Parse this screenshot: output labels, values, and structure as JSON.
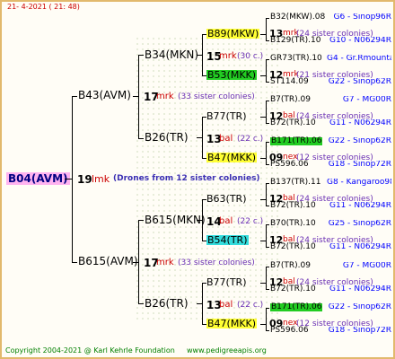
{
  "header": {
    "date": "21-  4-2021 ( 21: 48)"
  },
  "footer": {
    "copyright": "Copyright 2004-2021 @ Karl Kehrle Foundation",
    "site": "www.pedigreeapis.org"
  },
  "root": {
    "name": "B04(AVM)",
    "num": "19",
    "mk": "lmk",
    "note": "(Drones from 12 sister colonies)"
  },
  "gen1": [
    {
      "name": "B43(AVM)",
      "num": "17",
      "mk": "mrk",
      "note": "(33 sister colonies)"
    },
    {
      "name": "B615(AVM)",
      "num": "17",
      "mk": "mrk",
      "note": "(33 sister colonies)"
    }
  ],
  "gen2": [
    {
      "name": "B34(MKN)",
      "num": "15",
      "mk": "mrk",
      "note": "(30 c.)"
    },
    {
      "name": "B26(TR)",
      "num": "13",
      "mk": "bal",
      "note": "(22 c.)"
    },
    {
      "name": "B615(MKN)",
      "num": "14",
      "mk": "bal",
      "note": "(22 c.)"
    },
    {
      "name": "B26(TR)",
      "num": "13",
      "mk": "bal",
      "note": "(22 c.)"
    }
  ],
  "gen3": [
    {
      "name": "B89(MKW)",
      "num": "13",
      "mk": "mrk",
      "note": "(24 sister colonies)",
      "hl": "y"
    },
    {
      "name": "B53(MKK)",
      "num": "12",
      "mk": "mrk",
      "note": "(21 sister colonies)",
      "hl": "g"
    },
    {
      "name": "B77(TR)",
      "num": "12",
      "mk": "bal",
      "note": "(24 sister colonies)",
      "hl": ""
    },
    {
      "name": "B47(MKK)",
      "num": "09",
      "mk": "nex",
      "note": "(12 sister colonies)",
      "hl": "y"
    },
    {
      "name": "B63(TR)",
      "num": "12",
      "mk": "bal",
      "note": "(24 sister colonies)",
      "hl": ""
    },
    {
      "name": "B54(TR)",
      "num": "12",
      "mk": "bal",
      "note": "(24 sister colonies)",
      "hl": "c"
    },
    {
      "name": "B77(TR)",
      "num": "12",
      "mk": "bal",
      "note": "(24 sister colonies)",
      "hl": ""
    },
    {
      "name": "B47(MKK)",
      "num": "09",
      "mk": "nex",
      "note": "(12 sister colonies)",
      "hl": "y"
    }
  ],
  "gen4": [
    {
      "left": "B32(MKW).08",
      "right": "G6 - Sinop96R",
      "hl": ""
    },
    {
      "left": "B129(TR).10",
      "right": "G10 - N06294R",
      "hl": ""
    },
    {
      "left": "GR73(TR).10",
      "right": "G4 - Gr.Rmounta",
      "hl": ""
    },
    {
      "left": "ST114.09",
      "right": "G22 - Sinop62R",
      "hl": ""
    },
    {
      "left": "B7(TR).09",
      "right": "G7 - MG00R",
      "hl": ""
    },
    {
      "left": "B72(TR).10",
      "right": "G11 - N06294R",
      "hl": ""
    },
    {
      "left": "B171(TR).06",
      "right": "G22 - Sinop62R",
      "hl": "g"
    },
    {
      "left": "PS596.06",
      "right": "G18 - Sinop72R",
      "hl": ""
    },
    {
      "left": "B137(TR).11",
      "right": "G8 - Kangaroo98R",
      "hl": ""
    },
    {
      "left": "B72(TR).10",
      "right": "G11 - N06294R",
      "hl": ""
    },
    {
      "left": "B70(TR).10",
      "right": "G25 - Sinop62R",
      "hl": ""
    },
    {
      "left": "B72(TR).10",
      "right": "G11 - N06294R",
      "hl": ""
    },
    {
      "left": "B7(TR).09",
      "right": "G7 - MG00R",
      "hl": ""
    },
    {
      "left": "B72(TR).10",
      "right": "G11 - N06294R",
      "hl": ""
    },
    {
      "left": "B171(TR).06",
      "right": "G22 - Sinop62R",
      "hl": "g"
    },
    {
      "left": "PS596.06",
      "right": "G18 - Sinop72R",
      "hl": ""
    }
  ]
}
